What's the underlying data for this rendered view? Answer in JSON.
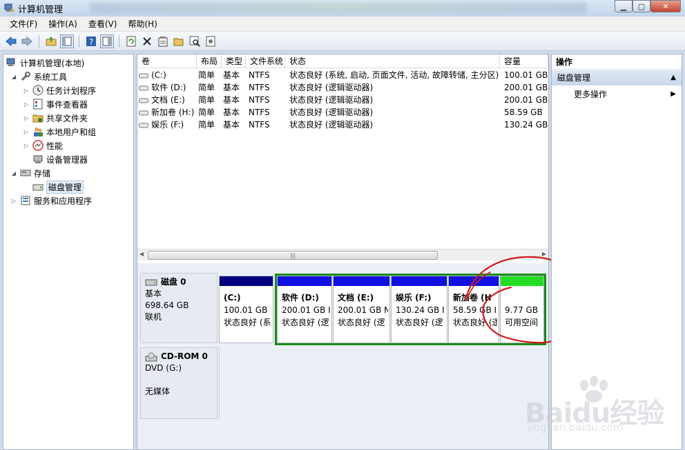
{
  "window": {
    "title": "计算机管理",
    "controls": [
      "minimize-icon",
      "maximize-icon",
      "close-icon"
    ]
  },
  "menu": [
    "文件(F)",
    "操作(A)",
    "查看(V)",
    "帮助(H)"
  ],
  "toolbar": {
    "icons": [
      "back-arrow-icon",
      "forward-arrow-icon",
      "up-folder-icon",
      "show-tree-icon",
      "help-icon",
      "console-view-icon",
      "refresh-icon",
      "delete-icon",
      "properties-icon",
      "open-folder-icon",
      "search-icon",
      "settings-icon"
    ]
  },
  "tree": [
    {
      "label": "计算机管理(本地)",
      "icon": "computer-management-icon",
      "level": 0,
      "arrow": ""
    },
    {
      "label": "系统工具",
      "icon": "tools-icon",
      "level": 1,
      "arrow": "◢"
    },
    {
      "label": "任务计划程序",
      "icon": "clock-icon",
      "level": 2,
      "arrow": "▷"
    },
    {
      "label": "事件查看器",
      "icon": "event-viewer-icon",
      "level": 2,
      "arrow": "▷"
    },
    {
      "label": "共享文件夹",
      "icon": "shared-folder-icon",
      "level": 2,
      "arrow": "▷"
    },
    {
      "label": "本地用户和组",
      "icon": "users-icon",
      "level": 2,
      "arrow": "▷"
    },
    {
      "label": "性能",
      "icon": "performance-icon",
      "level": 2,
      "arrow": "▷"
    },
    {
      "label": "设备管理器",
      "icon": "device-manager-icon",
      "level": 2,
      "arrow": ""
    },
    {
      "label": "存储",
      "icon": "storage-icon",
      "level": 1,
      "arrow": "◢"
    },
    {
      "label": "磁盘管理",
      "icon": "disk-management-icon",
      "level": 2,
      "arrow": "",
      "selected": true
    },
    {
      "label": "服务和应用程序",
      "icon": "services-icon",
      "level": 1,
      "arrow": "▷"
    }
  ],
  "volumes": {
    "columns": [
      "卷",
      "布局",
      "类型",
      "文件系统",
      "状态",
      "容量"
    ],
    "rows": [
      [
        "(C:)",
        "简单",
        "基本",
        "NTFS",
        "状态良好 (系统, 启动, 页面文件, 活动, 故障转储, 主分区)",
        "100.01 GB"
      ],
      [
        "软件 (D:)",
        "简单",
        "基本",
        "NTFS",
        "状态良好 (逻辑驱动器)",
        "200.01 GB"
      ],
      [
        "文档 (E:)",
        "简单",
        "基本",
        "NTFS",
        "状态良好 (逻辑驱动器)",
        "200.01 GB"
      ],
      [
        "新加卷 (H:)",
        "简单",
        "基本",
        "NTFS",
        "状态良好 (逻辑驱动器)",
        "58.59 GB"
      ],
      [
        "娱乐 (F:)",
        "简单",
        "基本",
        "NTFS",
        "状态良好 (逻辑驱动器)",
        "130.24 GB"
      ]
    ]
  },
  "disk0": {
    "name": "磁盘 0",
    "type": "基本",
    "size": "698.64 GB",
    "status": "联机",
    "partitions": [
      {
        "name": "(C:)",
        "size": "100.01 GB",
        "status": "状态良好 (系",
        "color": "#00007f"
      },
      {
        "name": "软件 (D:)",
        "size": "200.01 GB I",
        "status": "状态良好 (逻",
        "color": "#1010e0"
      },
      {
        "name": "文档 (E:)",
        "size": "200.01 GB N",
        "status": "状态良好 (逻",
        "color": "#1010e0"
      },
      {
        "name": "娱乐 (F:)",
        "size": "130.24 GB I",
        "status": "状态良好 (逻",
        "color": "#1010e0"
      },
      {
        "name": "新加卷 (H",
        "size": "58.59 GB I",
        "status": "状态良好 (逻",
        "color": "#1010e0"
      },
      {
        "name": "",
        "size": "9.77 GB",
        "status": "可用空间",
        "color": "#22dd22"
      }
    ]
  },
  "cdrom": {
    "name": "CD-ROM 0",
    "type": "DVD (G:)",
    "status": "无媒体"
  },
  "actions": {
    "header": "操作",
    "group": "磁盘管理",
    "item": "更多操作"
  },
  "watermark": {
    "text": "Baidu经验",
    "url": "jingyan.baidu.com"
  },
  "colors": {
    "primary_partition": "#00007f",
    "logical_partition": "#1010e0",
    "free_space": "#22dd22",
    "extended_border": "#1a8a1a",
    "annotation": "#d01818"
  }
}
